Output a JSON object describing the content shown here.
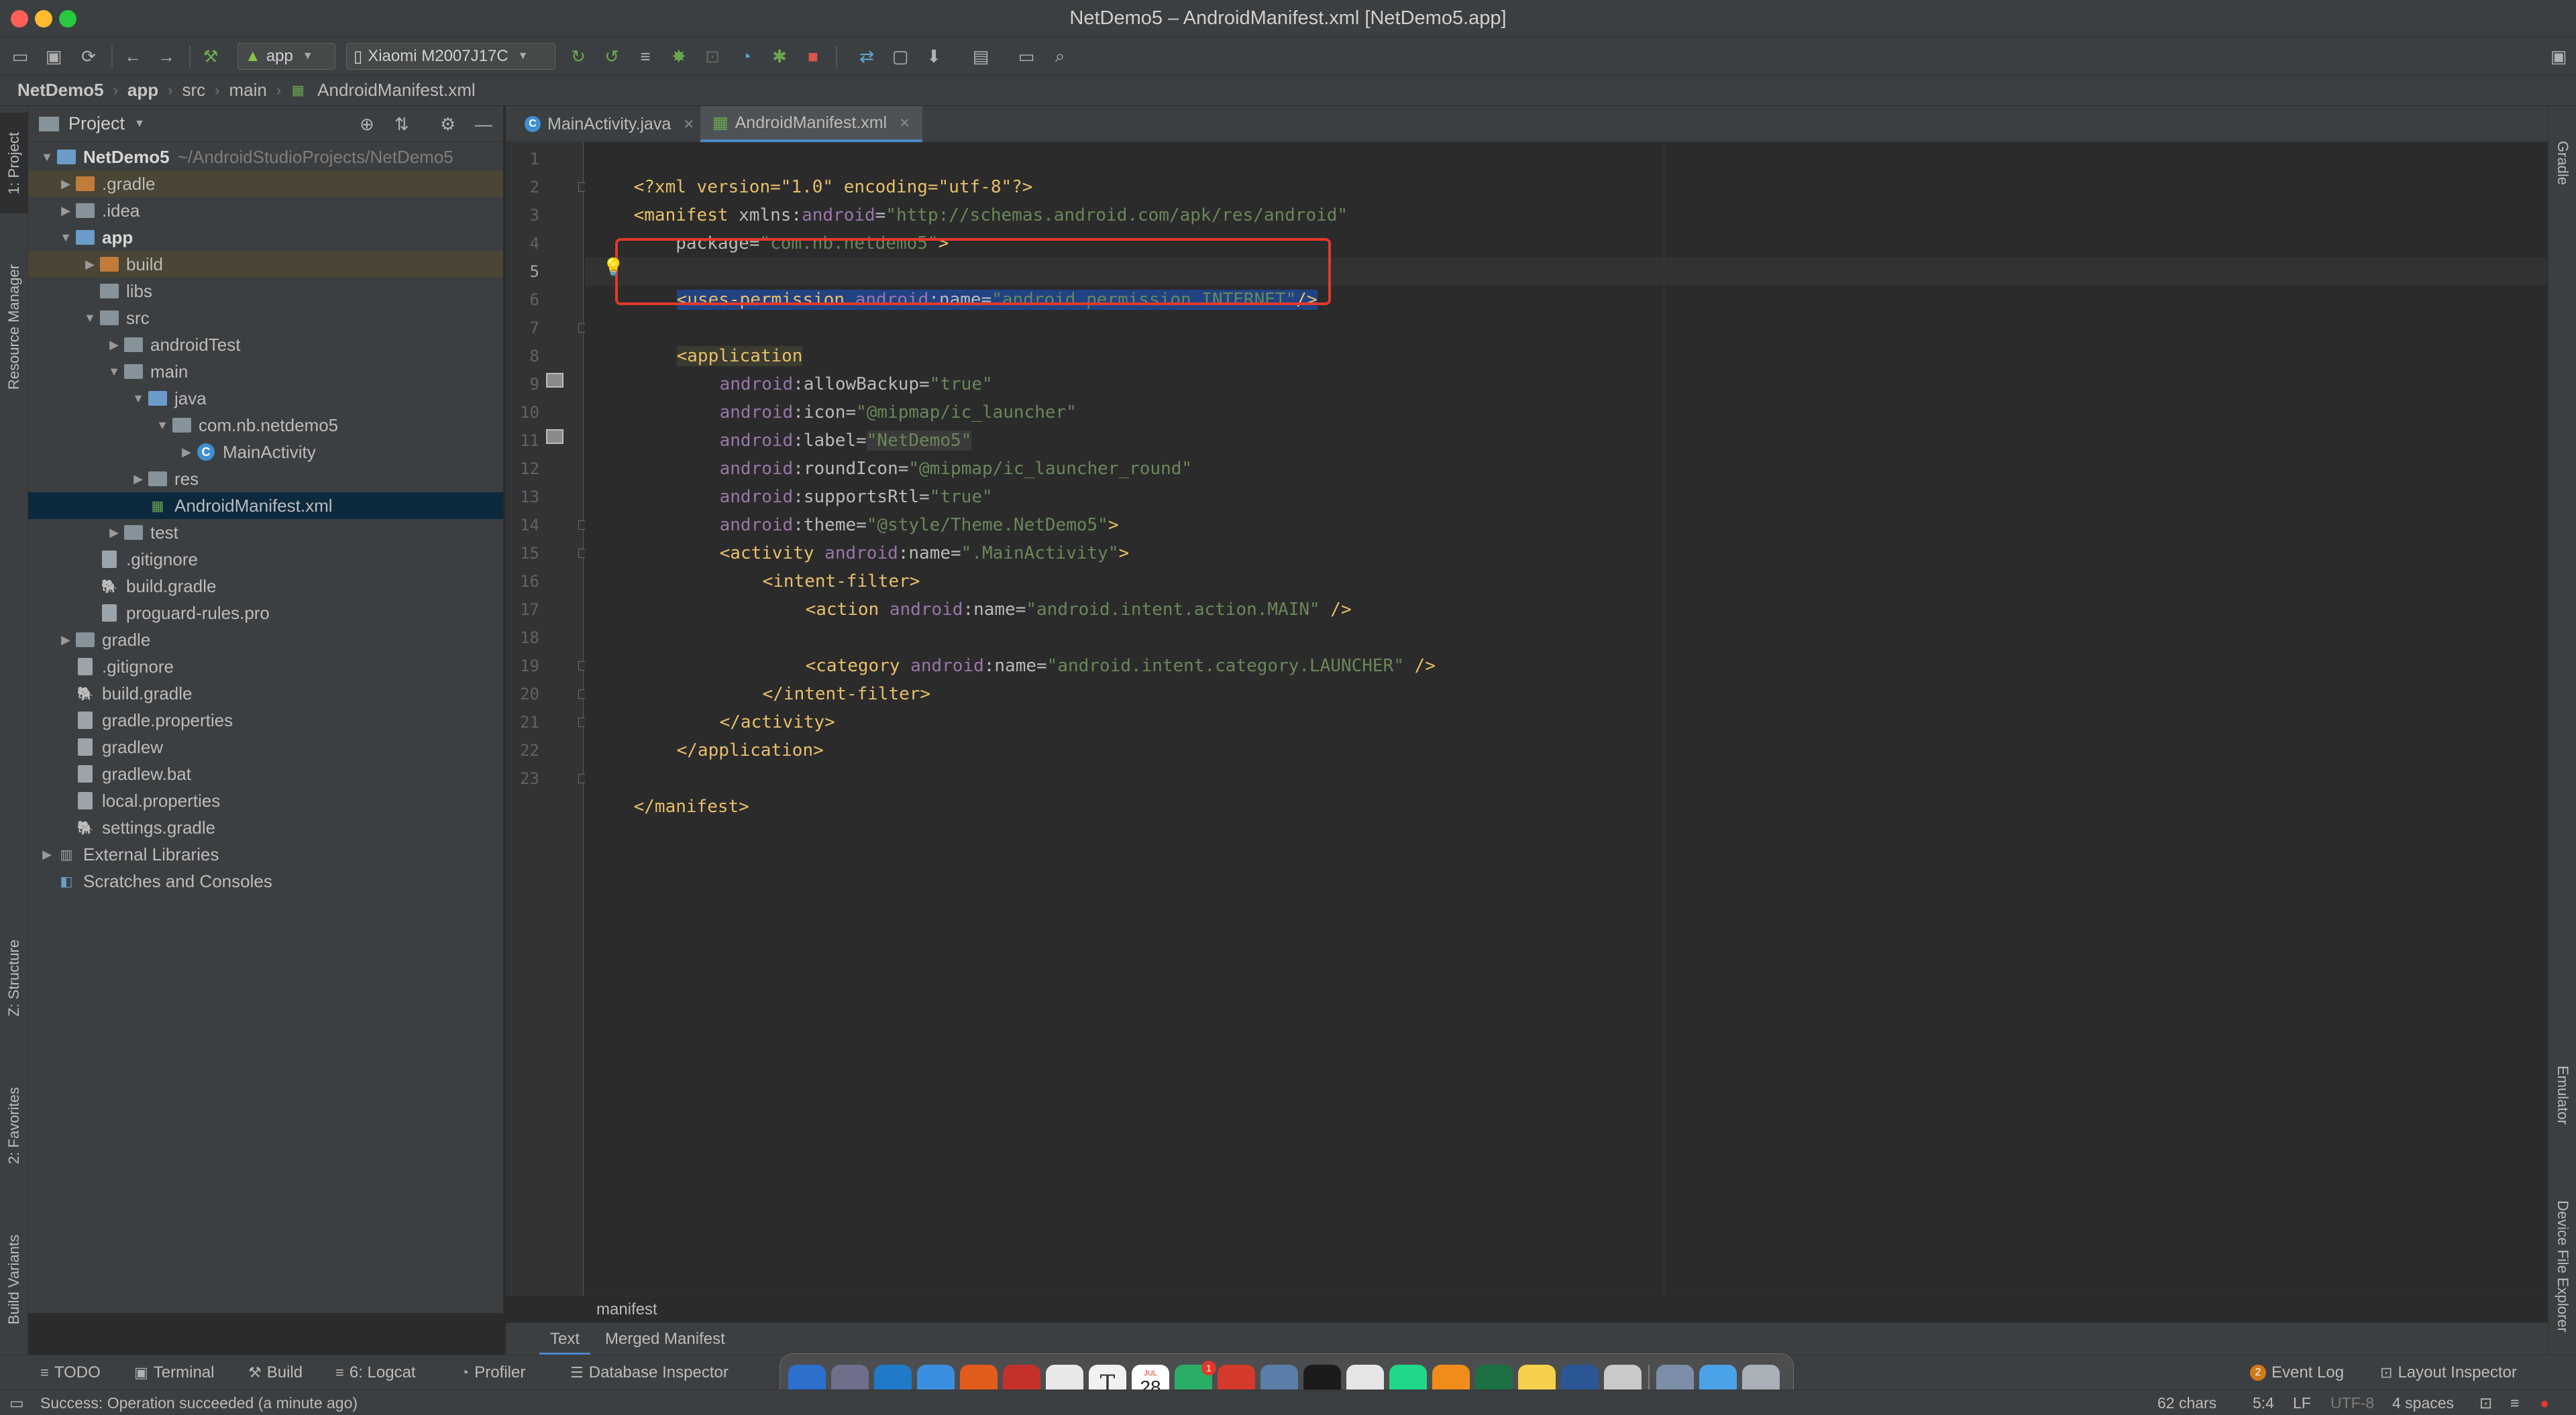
{
  "window": {
    "title": "NetDemo5 – AndroidManifest.xml [NetDemo5.app]"
  },
  "toolbar": {
    "run_config": "app",
    "device": "Xiaomi M2007J17C"
  },
  "breadcrumb": [
    "NetDemo5",
    "app",
    "src",
    "main",
    "AndroidManifest.xml"
  ],
  "left_strip": {
    "project_tab": "1: Project",
    "resource_manager_tab": "Resource Manager",
    "structure_tab": "Z: Structure",
    "favorites_tab": "2: Favorites",
    "build_variants_tab": "Build Variants"
  },
  "right_strip": {
    "gradle_tab": "Gradle",
    "emulator_tab": "Emulator",
    "device_file_explorer_tab": "Device File Explorer"
  },
  "project_panel": {
    "title": "Project",
    "tree": [
      {
        "label": "NetDemo5",
        "extra": "~/AndroidStudioProjects/NetDemo5"
      },
      {
        "label": ".gradle"
      },
      {
        "label": ".idea"
      },
      {
        "label": "app"
      },
      {
        "label": "build"
      },
      {
        "label": "libs"
      },
      {
        "label": "src"
      },
      {
        "label": "androidTest"
      },
      {
        "label": "main"
      },
      {
        "label": "java"
      },
      {
        "label": "com.nb.netdemo5"
      },
      {
        "label": "MainActivity"
      },
      {
        "label": "res"
      },
      {
        "label": "AndroidManifest.xml"
      },
      {
        "label": "test"
      },
      {
        "label": ".gitignore"
      },
      {
        "label": "build.gradle"
      },
      {
        "label": "proguard-rules.pro"
      },
      {
        "label": "gradle"
      },
      {
        "label": ".gitignore"
      },
      {
        "label": "build.gradle"
      },
      {
        "label": "gradle.properties"
      },
      {
        "label": "gradlew"
      },
      {
        "label": "gradlew.bat"
      },
      {
        "label": "local.properties"
      },
      {
        "label": "settings.gradle"
      },
      {
        "label": "External Libraries"
      },
      {
        "label": "Scratches and Consoles"
      }
    ]
  },
  "editor": {
    "tabs": [
      {
        "label": "MainActivity.java"
      },
      {
        "label": "AndroidManifest.xml"
      }
    ],
    "line_numbers": [
      "1",
      "2",
      "3",
      "4",
      "5",
      "6",
      "7",
      "8",
      "9",
      "10",
      "11",
      "12",
      "13",
      "14",
      "15",
      "16",
      "17",
      "18",
      "19",
      "20",
      "21",
      "22",
      "23"
    ],
    "code": {
      "l1": "<?xml version=\"1.0\" encoding=\"utf-8\"?>",
      "l2_tag": "<manifest",
      "l2_attr": " xmlns:",
      "l2_ns": "android",
      "l2_eq": "=",
      "l2_val": "\"http://schemas.android.com/apk/res/android\"",
      "l3_attr": "    package=",
      "l3_val": "\"com.nb.netdemo5\"",
      "l3_end": ">",
      "l5_tag": "<uses-permission",
      "l5_ns": "android",
      "l5_attr": ":name=",
      "l5_val": "\"android.permission.INTERNET\"",
      "l5_end": "/>",
      "l7_tag": "<application",
      "l8_ns": "android",
      "l8_attr": ":allowBackup=",
      "l8_val": "\"true\"",
      "l9_ns": "android",
      "l9_attr": ":icon=",
      "l9_val": "\"@mipmap/ic_launcher\"",
      "l10_ns": "android",
      "l10_attr": ":label=",
      "l10_val": "\"NetDemo5\"",
      "l11_ns": "android",
      "l11_attr": ":roundIcon=",
      "l11_val": "\"@mipmap/ic_launcher_round\"",
      "l12_ns": "android",
      "l12_attr": ":supportsRtl=",
      "l12_val": "\"true\"",
      "l13_ns": "android",
      "l13_attr": ":theme=",
      "l13_val": "\"@style/Theme.NetDemo5\"",
      "l13_end": ">",
      "l14_tag": "<activity",
      "l14_ns": "android",
      "l14_attr": ":name=",
      "l14_val": "\".MainActivity\"",
      "l14_end": ">",
      "l15_tag": "<intent-filter>",
      "l16_tag": "<action",
      "l16_ns": "android",
      "l16_attr": ":name=",
      "l16_val": "\"android.intent.action.MAIN\"",
      "l16_end": " />",
      "l18_tag": "<category",
      "l18_ns": "android",
      "l18_attr": ":name=",
      "l18_val": "\"android.intent.category.LAUNCHER\"",
      "l18_end": " />",
      "l19_tag": "</intent-filter>",
      "l20_tag": "</activity>",
      "l21_tag": "</application>",
      "l23_tag": "</manifest>"
    },
    "footer_crumb": "manifest",
    "mode_tabs": [
      "Text",
      "Merged Manifest"
    ]
  },
  "bottom_bar": {
    "todo": "TODO",
    "terminal": "Terminal",
    "build": "Build",
    "logcat": "6: Logcat",
    "profiler": "Profiler",
    "database_inspector": "Database Inspector",
    "event_log": "Event Log",
    "event_log_count": "2",
    "layout_inspector": "Layout Inspector"
  },
  "status_bar": {
    "message": "Success: Operation succeeded (a minute ago)",
    "chars": "62 chars",
    "position": "5:4",
    "line_sep": "LF",
    "encoding": "UTF-8",
    "indent": "4 spaces"
  },
  "dock": {
    "calendar_month": "JUL",
    "calendar_day": "28",
    "wechat_badge": "1"
  },
  "colors": {
    "accent": "#4a88c7",
    "highlight_box": "#e0392b",
    "tag": "#e8bf6a",
    "value": "#6a8759",
    "namespace": "#9876aa"
  }
}
